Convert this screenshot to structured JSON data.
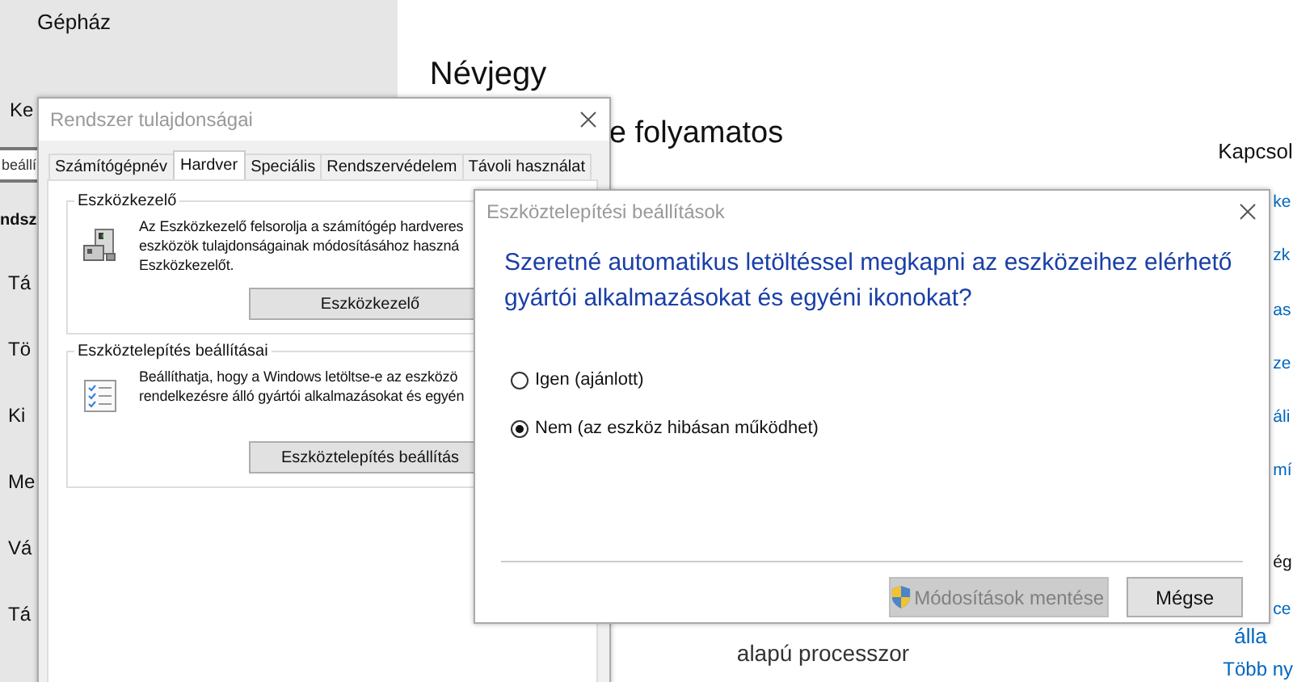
{
  "settings": {
    "sidebar": {
      "title": "Gépház",
      "cut_item": "Ke",
      "search": {
        "placeholder": "beállí"
      },
      "section": "ndsz",
      "items": [
        "Tá",
        "Tö",
        "Ki",
        "Me",
        "Vá",
        "Tá"
      ]
    },
    "main": {
      "heading": "Névjegy",
      "status": "e folyamatos",
      "processor": "alapú processzor"
    },
    "related": {
      "title": "Kapcsol",
      "items": [
        {
          "kind": "link",
          "label": "ke"
        },
        {
          "kind": "link",
          "label": "zk"
        },
        {
          "kind": "link",
          "label": "as"
        },
        {
          "kind": "link",
          "label": "ze"
        },
        {
          "kind": "link",
          "label": "áli"
        },
        {
          "kind": "link",
          "label": "mí"
        },
        {
          "kind": "heading",
          "label": "ég"
        },
        {
          "kind": "link",
          "label": "ce"
        },
        {
          "kind": "link",
          "label": "álla"
        },
        {
          "kind": "link",
          "label": "Több ny"
        }
      ]
    }
  },
  "system_properties": {
    "title": "Rendszer tulajdonságai",
    "tabs": [
      {
        "label": "Számítógépnév",
        "selected": false
      },
      {
        "label": "Hardver",
        "selected": true
      },
      {
        "label": "Speciális",
        "selected": false
      },
      {
        "label": "Rendszervédelem",
        "selected": false
      },
      {
        "label": "Távoli használat",
        "selected": false
      }
    ],
    "groups": [
      {
        "kind": "device_manager",
        "title": "Eszközkezelő",
        "description": [
          "Az Eszközkezelő felsorolja a számítógép hardveres",
          "eszközök tulajdonságainak módosításához haszná",
          "Eszközkezelőt."
        ],
        "button": "Eszközkezelő"
      },
      {
        "kind": "installation",
        "title": "Eszköztelepítés beállításai",
        "description": [
          "Beállíthatja, hogy a Windows letöltse-e az eszközö",
          "rendelkezésre álló gyártói alkalmazásokat és egyén"
        ],
        "button": "Eszköztelepítés beállítás"
      }
    ]
  },
  "installation_settings": {
    "title": "Eszköztelepítési beállítások",
    "question": [
      "Szeretné automatikus letöltéssel megkapni az eszközeihez elérhető",
      "gyártói alkalmazásokat és egyéni ikonokat?"
    ],
    "options": [
      {
        "label": "Igen (ajánlott)",
        "selected": false
      },
      {
        "label": "Nem (az eszköz hibásan működhet)",
        "selected": true
      }
    ],
    "buttons": [
      {
        "kind": "elevated",
        "label": "Módosítások mentése",
        "disabled": true
      },
      {
        "kind": "plain",
        "label": "Mégse",
        "disabled": false
      }
    ]
  }
}
